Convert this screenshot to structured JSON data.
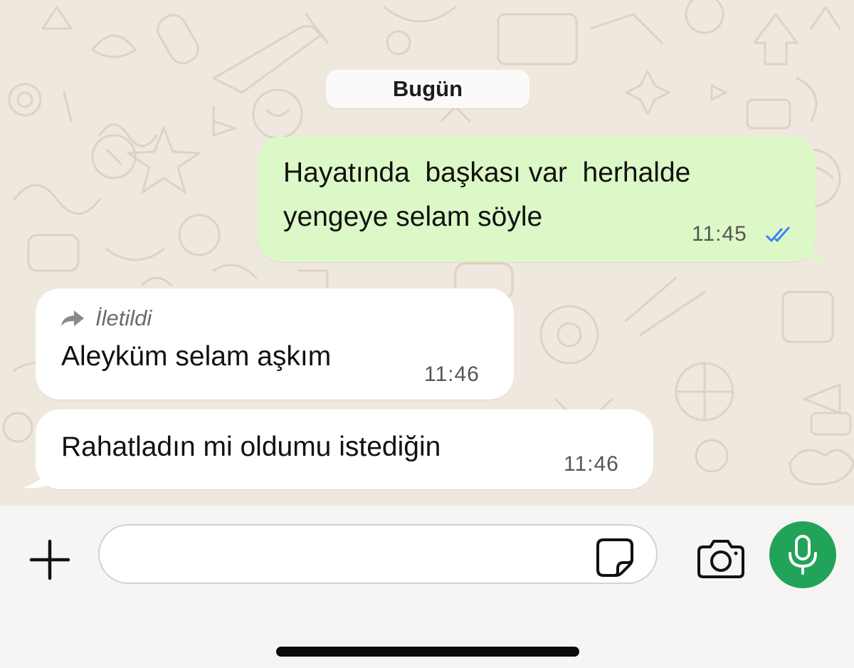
{
  "chat": {
    "date_separator": "Bugün",
    "messages": [
      {
        "direction": "outgoing",
        "line1": "Hayatında  başkası var  herhalde",
        "line2": "yengeye selam söyle",
        "time": "11:45",
        "status": "read",
        "tick_color": "#3b82f6"
      },
      {
        "direction": "incoming",
        "forwarded_label": "İletildi",
        "text": "Aleyküm selam aşkım",
        "time": "11:46"
      },
      {
        "direction": "incoming",
        "text": "Rahatladın mi oldumu istediğin",
        "time": "11:46"
      }
    ]
  },
  "composer": {
    "input_value": "",
    "input_placeholder": "",
    "icons": [
      "plus-icon",
      "sticker-icon",
      "camera-icon",
      "microphone-icon"
    ]
  },
  "colors": {
    "wallpaper": "#efe8de",
    "outgoing_bubble": "#dcf8c6",
    "incoming_bubble": "#ffffff",
    "mic_button": "#22a35a"
  }
}
